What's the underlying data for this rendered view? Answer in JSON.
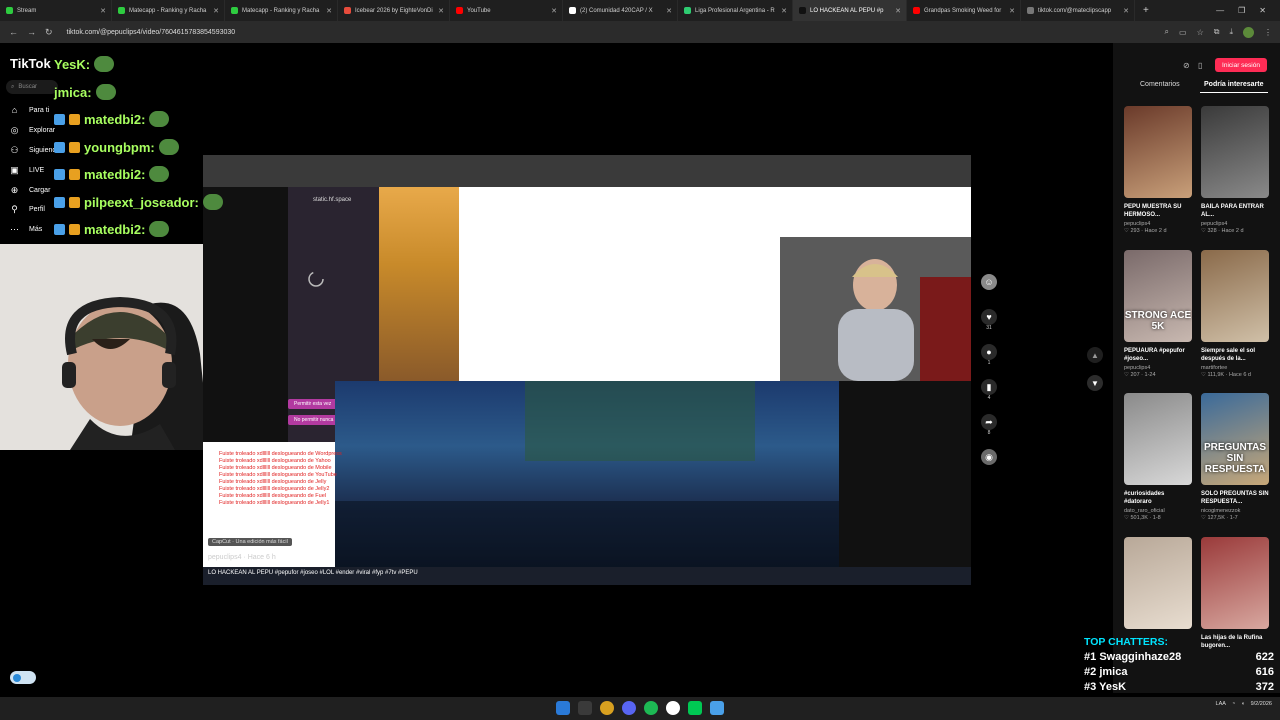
{
  "browser": {
    "tabs": [
      {
        "label": "Stream",
        "color": "#2ecc40"
      },
      {
        "label": "Matecapp - Ranking y Racha",
        "color": "#2ecc40"
      },
      {
        "label": "Matecapp - Ranking y Racha",
        "color": "#2ecc40"
      },
      {
        "label": "Icebear 2026 by EighteVonDi",
        "color": "#e74c3c"
      },
      {
        "label": "YouTube",
        "color": "#ff0000"
      },
      {
        "label": "(2) Comunidad 420CAP / X",
        "color": "#ffffff"
      },
      {
        "label": "Liga Profesional Argentina - R",
        "color": "#2ecc71"
      },
      {
        "label": "LO HACKEAN AL PEPU #p",
        "color": "#111111"
      },
      {
        "label": "Grandpas Smoking Weed for",
        "color": "#ff0000"
      },
      {
        "label": "tiktok.com/@mateclipscapp",
        "color": "#777777"
      }
    ],
    "url": "tiktok.com/@pepuclips4/video/7604615783854593030"
  },
  "tiktok": {
    "logo": "TikTok",
    "search_placeholder": "Buscar",
    "nav": [
      {
        "label": "Para ti",
        "icon": "home-icon",
        "glyph": "⌂"
      },
      {
        "label": "Explorar",
        "icon": "compass-icon",
        "glyph": "◎"
      },
      {
        "label": "Siguiendo",
        "icon": "following-icon",
        "glyph": "⚇"
      },
      {
        "label": "LIVE",
        "icon": "live-icon",
        "glyph": "▣"
      },
      {
        "label": "Cargar",
        "icon": "upload-icon",
        "glyph": "⊕"
      },
      {
        "label": "Perfil",
        "icon": "profile-icon",
        "glyph": "⚲"
      },
      {
        "label": "Más",
        "icon": "more-icon",
        "glyph": "⋯"
      }
    ],
    "login": "Iniciar sesión",
    "tabs": [
      "Comentarios",
      "Podría interesarte"
    ],
    "video": {
      "caption": "LO HACKEAN AL PEPU #pepufor #joseo #LOL #ender #viral #fyp #7tv #PEPU",
      "capcut": "CapCut · Una edición más fácil",
      "username": "pepuclips4 · Hace 6 h",
      "inner_site": "static.hf.space",
      "inner_btn": "Permitir esta vez",
      "inner_btn2": "No permitir nunca",
      "red_lines": [
        "Fuiste troleado xdllllll deslogueando de Wordpress",
        "Fuiste troleado xdllllll deslogueando de Yahoo",
        "Fuiste troleado xdllllll deslogueando de Mobile",
        "Fuiste troleado xdllllll deslogueando de YouTube",
        "Fuiste troleado xdllllll deslogueando de Jelly",
        "Fuiste troleado xdllllll deslogueando de Jelly2",
        "Fuiste troleado xdllllll deslogueando de Fuel",
        "Fuiste troleado xdllllll deslogueando de Jelly1"
      ]
    },
    "actions": [
      {
        "icon": "heart-icon",
        "glyph": "♥",
        "count": "31"
      },
      {
        "icon": "comment-icon",
        "glyph": "●",
        "count": "1"
      },
      {
        "icon": "bookmark-icon",
        "glyph": "▮",
        "count": "4"
      },
      {
        "icon": "share-icon",
        "glyph": "➦",
        "count": "8"
      }
    ],
    "recommended": [
      {
        "title": "PEPU MUESTRA SU HERMOSO...",
        "author": "pepuclips4",
        "stats": "♡ 293 · Hace 2 d",
        "overlay": "",
        "color1": "#6a3a2a",
        "color2": "#c9a07a"
      },
      {
        "title": "BAILA PARA ENTRAR AL...",
        "author": "pepuclips4",
        "stats": "♡ 328 · Hace 2 d",
        "overlay": "",
        "color1": "#3a3a3a",
        "color2": "#8a8a8a"
      },
      {
        "title": "PEPUAURA #pepufor #joseo...",
        "author": "pepuclips4",
        "stats": "♡ 207 · 1-24",
        "overlay": "STRONG ACE 5K",
        "color1": "#7a6a6a",
        "color2": "#c8b8b0"
      },
      {
        "title": "Siempre sale el sol después de la...",
        "author": "martifortee",
        "stats": "♡ 111,9K · Hace 6 d",
        "overlay": "",
        "color1": "#8a6a4a",
        "color2": "#d0c0a8"
      },
      {
        "title": "#curiosidades #datoraro",
        "author": "dato_raro_oficial",
        "stats": "♡ 501,3K · 1-8",
        "overlay": "",
        "color1": "#8a8a8a",
        "color2": "#d8d8d8"
      },
      {
        "title": "SOLO PREGUNTAS SIN RESPUESTA...",
        "author": "nicogimenezzok",
        "stats": "♡ 127,5K · 1-7",
        "overlay": "PREGUNTAS SIN RESPUESTA",
        "color1": "#3a6a9a",
        "color2": "#c8a878"
      },
      {
        "title": "",
        "author": "",
        "stats": "",
        "overlay": "",
        "color1": "#b8a898",
        "color2": "#e8ddd0"
      },
      {
        "title": "Las hijas de la Rufina bugoren...",
        "author": "",
        "stats": "",
        "overlay": "",
        "color1": "#9a3a3a",
        "color2": "#d8a8a0"
      }
    ]
  },
  "chat": [
    {
      "user": "YesK:",
      "color": "#a8ff60"
    },
    {
      "user": "jmica:",
      "color": "#a8ff60"
    },
    {
      "user": "matedbi2:",
      "color": "#a8ff60"
    },
    {
      "user": "youngbpm:",
      "color": "#a8ff60"
    },
    {
      "user": "matedbi2:",
      "color": "#a8ff60"
    },
    {
      "user": "pilpeext_joseador:",
      "color": "#a8ff60"
    },
    {
      "user": "matedbi2:",
      "color": "#a8ff60"
    }
  ],
  "top_chatters": {
    "title": "TOP CHATTERS:",
    "rows": [
      {
        "rank": "#1",
        "name": "Swagginhaze28",
        "count": "622"
      },
      {
        "rank": "#2",
        "name": "jmica",
        "count": "616"
      },
      {
        "rank": "#3",
        "name": "YesK",
        "count": "372"
      }
    ]
  },
  "taskbar": {
    "lang": "LAA",
    "time": "9/2/2026"
  }
}
